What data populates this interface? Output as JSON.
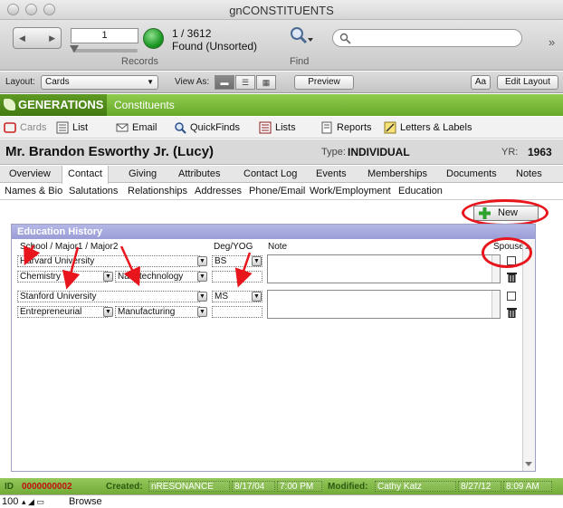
{
  "window": {
    "title": "gnCONSTITUENTS"
  },
  "toolbar": {
    "record_input": "1",
    "record_count": "1 / 3612",
    "found_status": "Found (Unsorted)",
    "records_caption": "Records",
    "find_caption": "Find",
    "search_placeholder": ""
  },
  "layoutbar": {
    "layout_label": "Layout:",
    "layout_value": "Cards",
    "view_as_label": "View As:",
    "preview_label": "Preview",
    "aa_label": "Aa",
    "edit_layout_label": "Edit Layout"
  },
  "app": {
    "brand": "GENERATIONS",
    "section": "Constituents"
  },
  "nav": [
    {
      "label": "Cards",
      "icon": "cards-icon"
    },
    {
      "label": "List",
      "icon": "list-icon"
    },
    {
      "label": "Email",
      "icon": "email-icon"
    },
    {
      "label": "QuickFinds",
      "icon": "magnifier-icon"
    },
    {
      "label": "Lists",
      "icon": "lists-icon"
    },
    {
      "label": "Reports",
      "icon": "reports-icon"
    },
    {
      "label": "Letters & Labels",
      "icon": "letters-icon"
    }
  ],
  "person": {
    "name": "Mr. Brandon Esworthy Jr. (Lucy)",
    "type_label": "Type:",
    "type_value": "INDIVIDUAL",
    "yr_label": "YR:",
    "yr_value": "1963"
  },
  "tabs": [
    "Overview",
    "Contact",
    "Giving",
    "Attributes",
    "Contact Log",
    "Events",
    "Memberships",
    "Documents",
    "Notes"
  ],
  "active_tab": "Contact",
  "subtabs": [
    "Names & Bio",
    "Salutations",
    "Relationships",
    "Addresses",
    "Phone/Email",
    "Work/Employment",
    "Education"
  ],
  "active_subtab": "Education",
  "education": {
    "new_button": "New",
    "panel_title": "Education History",
    "col_school": "School / Major1 / Major2",
    "col_deg": "Deg/YOG",
    "col_note": "Note",
    "col_spouse": "Spouse",
    "rows": [
      {
        "school": "Harvard University",
        "major1": "Chemistry",
        "major2": "Nanotechnology",
        "degree": "BS",
        "yog": ""
      },
      {
        "school": "Stanford University",
        "major1": "Entrepreneurial",
        "major2": "Manufacturing",
        "degree": "MS",
        "yog": ""
      }
    ]
  },
  "footer": {
    "id_label": "ID",
    "id_value": "0000000002",
    "created_label": "Created:",
    "created_by": "nRESONANCE",
    "created_date": "8/17/04",
    "created_time": "7:00 PM",
    "modified_label": "Modified:",
    "modified_by": "Cathy Katz",
    "modified_date": "8/27/12",
    "modified_time": "8:09 AM"
  },
  "status": {
    "zoom": "100",
    "mode": "Browse"
  },
  "colors": {
    "header_green": "#67a92a",
    "panel_blue": "#9a9dd6",
    "annotation_red": "#e8161c"
  }
}
